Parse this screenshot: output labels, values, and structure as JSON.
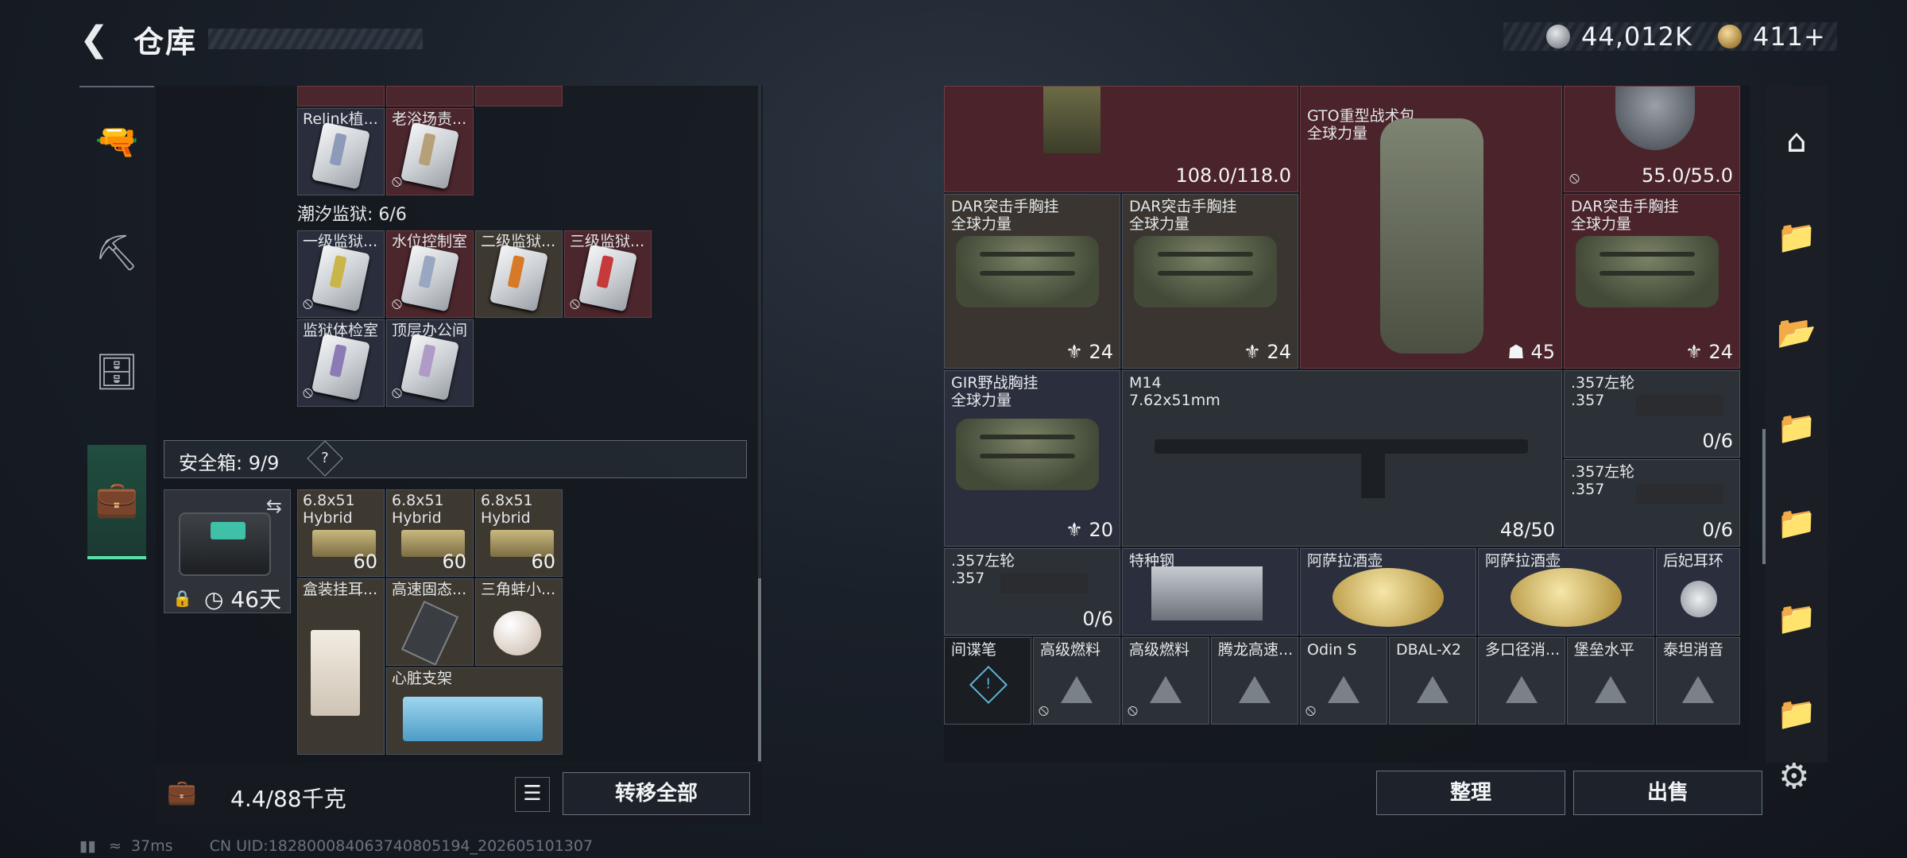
{
  "header": {
    "back_icon": "back-arrow-icon",
    "title": "仓库"
  },
  "currency": {
    "silver": "44,012K",
    "gold": "411+"
  },
  "left_rail": [
    "pistol-icon",
    "armor-icon",
    "backpack-icon",
    "briefcase-icon"
  ],
  "left": {
    "top_row": [
      {
        "label": "Relink植...",
        "stripe": "#8d9ab8"
      },
      {
        "label": "老浴场责...",
        "stripe": "#b6a07a"
      }
    ],
    "prison_title": "潮汐监狱: 6/6",
    "prison": [
      {
        "label": "一级监狱...",
        "stripe": "#c9b54a"
      },
      {
        "label": "水位控制室",
        "stripe": "#9aa7c2"
      },
      {
        "label": "二级监狱...",
        "stripe": "#d67a28"
      },
      {
        "label": "三级监狱...",
        "stripe": "#c63a3a"
      },
      {
        "label": "监狱体检室",
        "stripe": "#8c7ab6"
      },
      {
        "label": "顶层办公间",
        "stripe": "#b09ac8"
      }
    ],
    "safe_title": "安全箱: 9/9",
    "safe_help": "?",
    "safe_days": "46天",
    "ammo": [
      {
        "label": "6.8x51\nHybrid",
        "count": "60"
      },
      {
        "label": "6.8x51\nHybrid",
        "count": "60"
      },
      {
        "label": "6.8x51\nHybrid",
        "count": "60"
      }
    ],
    "misc": [
      {
        "label": "盒装挂耳..."
      },
      {
        "label": "高速固态..."
      },
      {
        "label": "三角蚌小..."
      },
      {
        "label": "心脏支架"
      }
    ],
    "weight": "4.4/88千克",
    "list_icon": "list-icon",
    "transfer_all": "转移全部"
  },
  "status": {
    "ping": "37ms",
    "uid": "CN UID:182800084063740805194_202605101307"
  },
  "right": {
    "row0": [
      {
        "label": "",
        "count": "108.0/118.0"
      },
      {
        "label": "GTO重型战术包\n全球力量",
        "count": "45"
      },
      {
        "label": "",
        "count": "55.0/55.0"
      }
    ],
    "row1": [
      {
        "label": "DAR突击手胸挂\n全球力量",
        "count": "24"
      },
      {
        "label": "DAR突击手胸挂\n全球力量",
        "count": "24"
      },
      {
        "label": "DAR突击手胸挂\n全球力量",
        "count": "24"
      }
    ],
    "gir": {
      "label": "GIR野战胸挂\n全球力量",
      "count": "20"
    },
    "m14": {
      "label": "M14\n7.62x51mm",
      "count": "48/50"
    },
    "rev1": {
      "label": ".357左轮\n.357",
      "count": "0/6"
    },
    "rev2": {
      "label": ".357左轮\n.357",
      "count": "0/6"
    },
    "rev3": {
      "label": ".357左轮\n.357",
      "count": "0/6"
    },
    "row4": [
      {
        "label": "特种钢"
      },
      {
        "label": "阿萨拉酒壶"
      },
      {
        "label": "阿萨拉酒壶"
      },
      {
        "label": "后妃耳环"
      }
    ],
    "row5": [
      {
        "label": "间谍笔"
      },
      {
        "label": "高级燃料"
      },
      {
        "label": "高级燃料"
      },
      {
        "label": "腾龙高速..."
      },
      {
        "label": "Odin S"
      },
      {
        "label": "DBAL-X2"
      },
      {
        "label": "多口径消..."
      },
      {
        "label": "堡垒水平"
      },
      {
        "label": "泰坦消音"
      }
    ],
    "sort": "整理",
    "sell": "出售"
  },
  "right_rail": [
    "house-icon",
    "folder-iv-icon",
    "folder-plus-icon",
    "folder-search-icon",
    "folder-gear-icon",
    "folder-up-icon",
    "folder-iv-2-icon"
  ]
}
